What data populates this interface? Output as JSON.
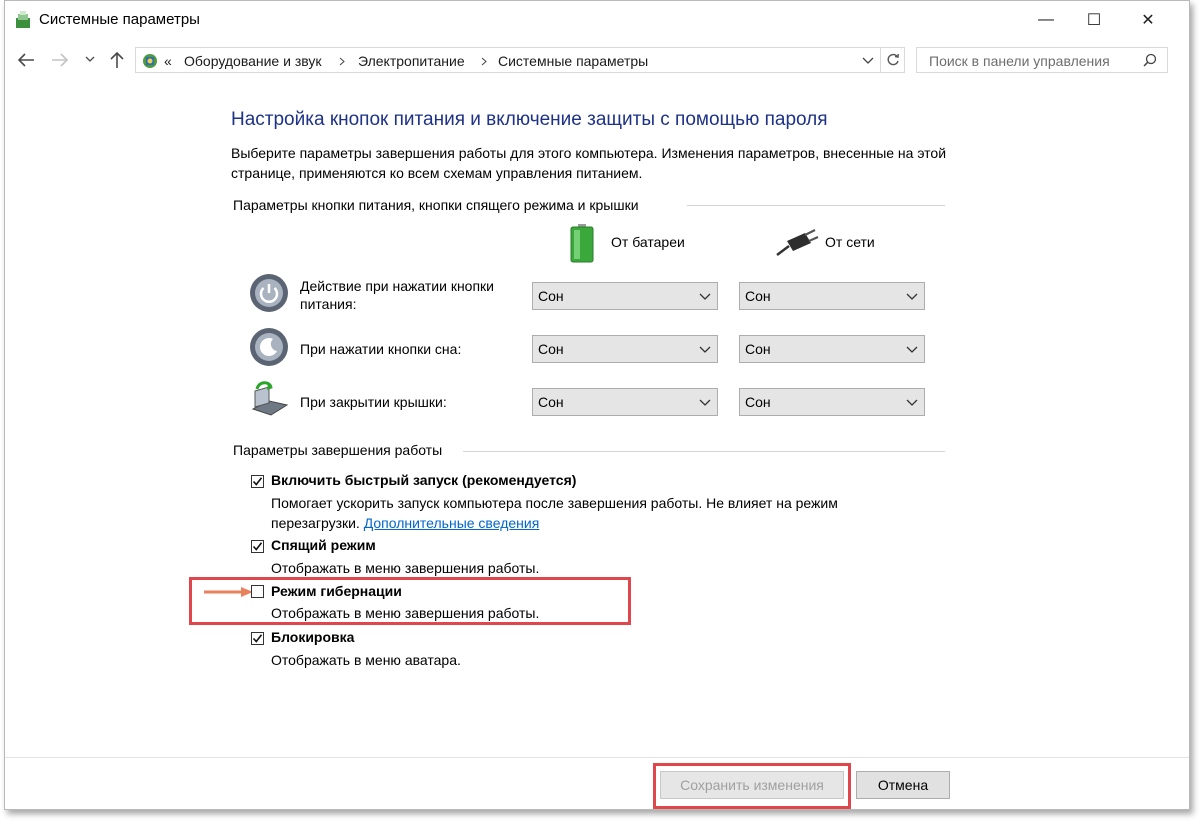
{
  "window": {
    "title": "Системные параметры",
    "controls": {
      "minimize": "—",
      "maximize": "☐",
      "close": "✕"
    }
  },
  "address_bar": {
    "breadcrumbs": [
      "«",
      "Оборудование и звук",
      "Электропитание",
      "Системные параметры"
    ],
    "search_placeholder": "Поиск в панели управления"
  },
  "main": {
    "heading": "Настройка кнопок питания и включение защиты с помощью пароля",
    "description": "Выберите параметры завершения работы для этого компьютера. Изменения параметров, внесенные на этой странице, применяются ко всем схемам управления питанием.",
    "power_section": {
      "title": "Параметры кнопки питания, кнопки спящего режима и крышки",
      "columns": {
        "battery": "От батареи",
        "plugged": "От сети"
      },
      "rows": [
        {
          "label": "Действие при нажатии кнопки питания:",
          "battery": "Сон",
          "plugged": "Сон",
          "icon": "power-button-icon"
        },
        {
          "label": "При нажатии кнопки сна:",
          "battery": "Сон",
          "plugged": "Сон",
          "icon": "sleep-button-icon"
        },
        {
          "label": "При закрытии крышки:",
          "battery": "Сон",
          "plugged": "Сон",
          "icon": "laptop-lid-icon"
        }
      ]
    },
    "shutdown_section": {
      "title": "Параметры завершения работы",
      "options": [
        {
          "title": "Включить быстрый запуск (рекомендуется)",
          "desc": "Помогает ускорить запуск компьютера после завершения работы. Не влияет на режим перезагрузки.",
          "link": "Дополнительные сведения",
          "checked": true
        },
        {
          "title": "Спящий режим",
          "desc": "Отображать в меню завершения работы.",
          "checked": true
        },
        {
          "title": "Режим гибернации",
          "desc": "Отображать в меню завершения работы.",
          "checked": false
        },
        {
          "title": "Блокировка",
          "desc": "Отображать в меню аватара.",
          "checked": true
        }
      ]
    }
  },
  "footer": {
    "save_label": "Сохранить изменения",
    "cancel_label": "Отмена"
  },
  "colors": {
    "heading": "#1e3287",
    "link": "#0066cc",
    "highlight": "#e0474c",
    "arrow": "#e8825c"
  }
}
